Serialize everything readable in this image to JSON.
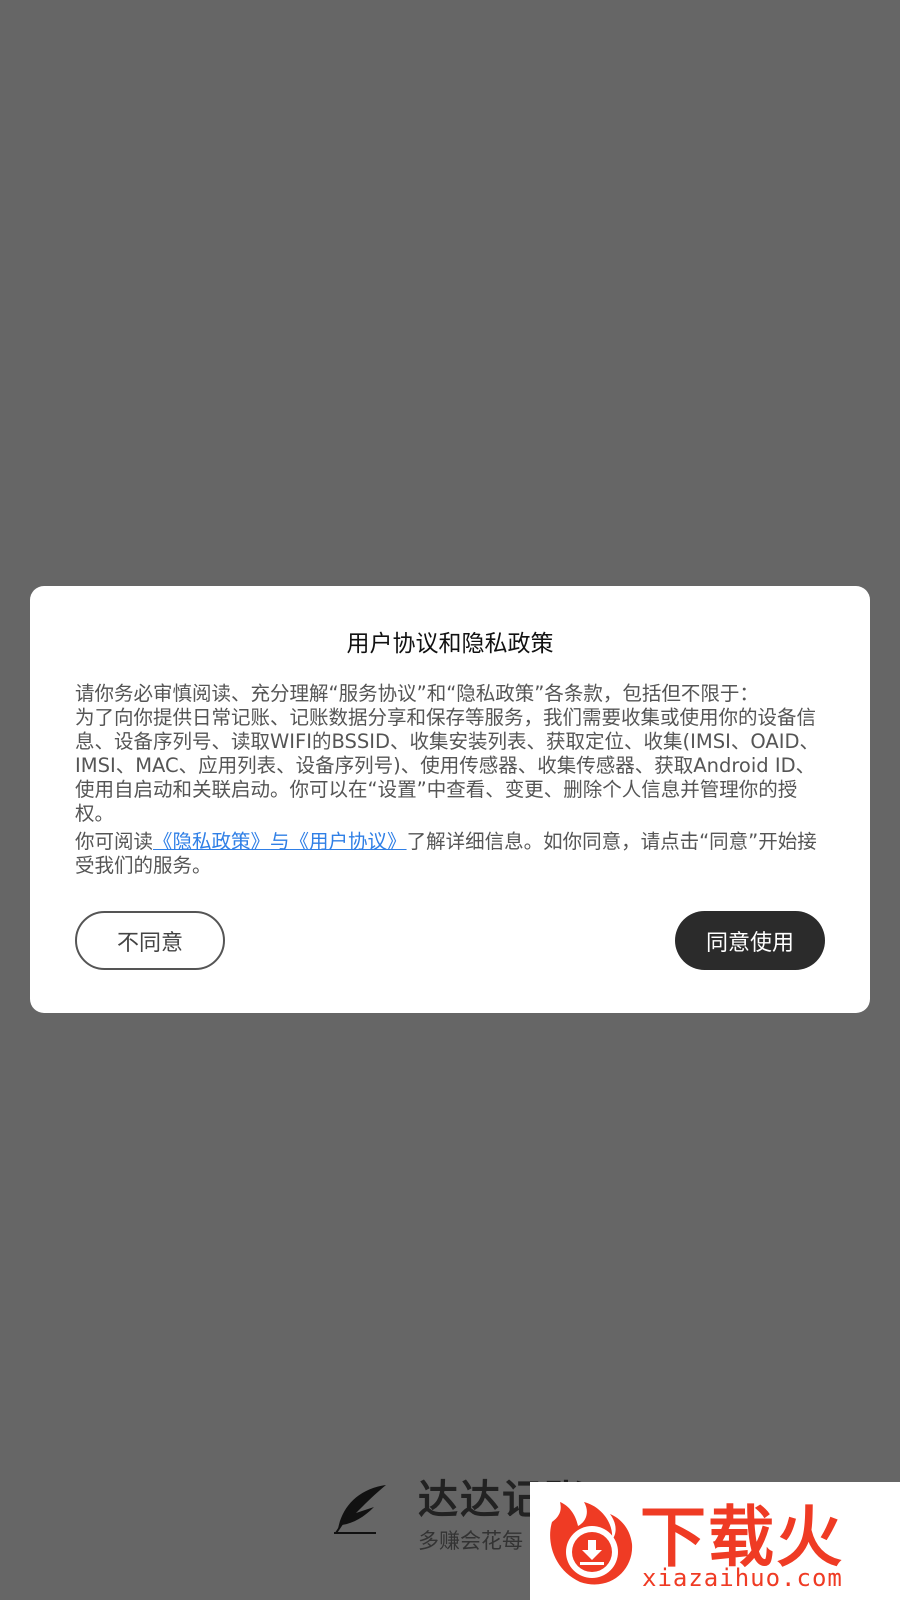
{
  "dialog": {
    "title": "用户协议和隐私政策",
    "body": "请你务必审慎阅读、充分理解“服务协议”和“隐私政策”各条款，包括但不限于：\n为了向你提供日常记账、记账数据分享和保存等服务，我们需要收集或使用你的设备信息、设备序列号、读取WIFI的BSSID、收集安装列表、获取定位、收集(IMSI、OAID、IMSI、MAC、应用列表、设备序列号)、使用传感器、收集传感器、获取Android ID、使用自启动和关联启动。你可以在“设置”中查看、变更、删除个人信息并管理你的授权。",
    "links_prefix": "你可阅读",
    "privacy_link": "《隐私政策》",
    "links_and": "与",
    "terms_link": "《用户协议》",
    "links_suffix": "了解详细信息。如你同意，请点击“同意”开始接受我们的服务。",
    "disagree_label": "不同意",
    "agree_label": "同意使用"
  },
  "brand": {
    "name": "达达记账",
    "slogan": "多赚会花每"
  },
  "watermark": {
    "text": "下载火",
    "url": "xiazaihuo.com"
  },
  "colors": {
    "overlay": "#666666",
    "link": "#2f7fe6",
    "agree_button": "#2b2b2b",
    "watermark": "#ef3b24"
  }
}
